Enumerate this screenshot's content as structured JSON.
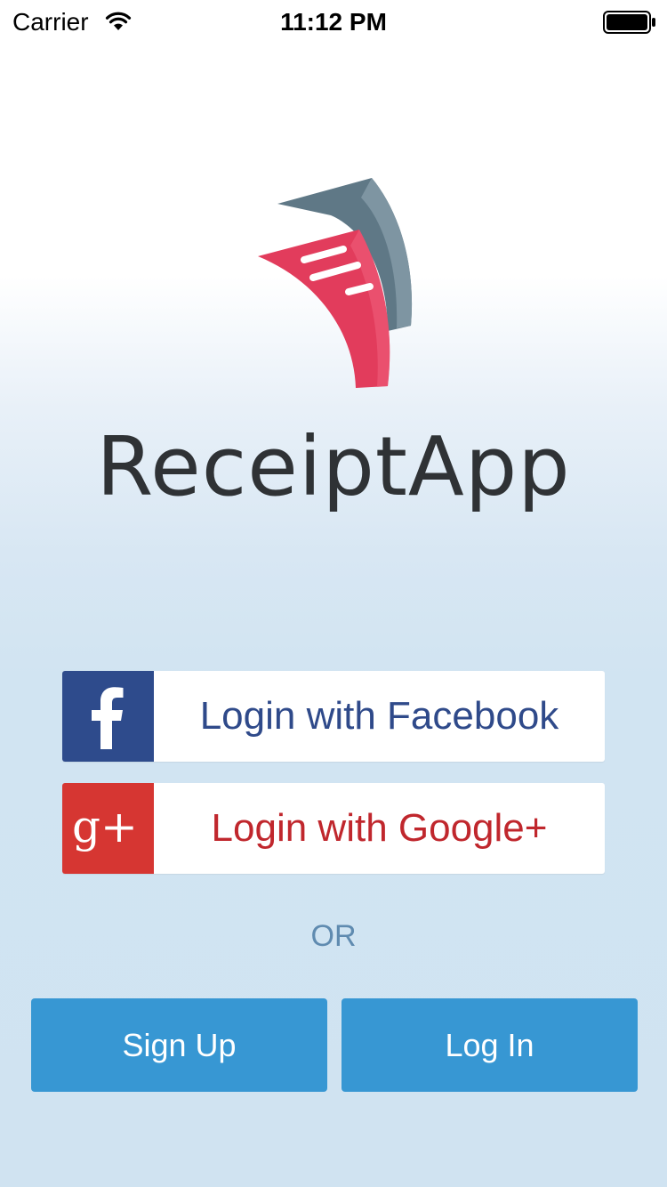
{
  "status_bar": {
    "carrier": "Carrier",
    "time": "11:12 PM",
    "wifi_icon": "wifi-icon",
    "battery_icon": "battery-icon"
  },
  "brand": {
    "logo_icon": "receipt-logo-icon",
    "app_name": "ReceiptApp"
  },
  "social_login": {
    "facebook": {
      "label": "Login with Facebook",
      "icon": "facebook-icon",
      "color": "#2e4b8c"
    },
    "google": {
      "label": "Login with Google+",
      "icon": "google-plus-icon",
      "icon_text": "g+",
      "color": "#d63632"
    }
  },
  "divider_text": "OR",
  "actions": {
    "sign_up": "Sign Up",
    "log_in": "Log In",
    "color": "#3797d3"
  }
}
